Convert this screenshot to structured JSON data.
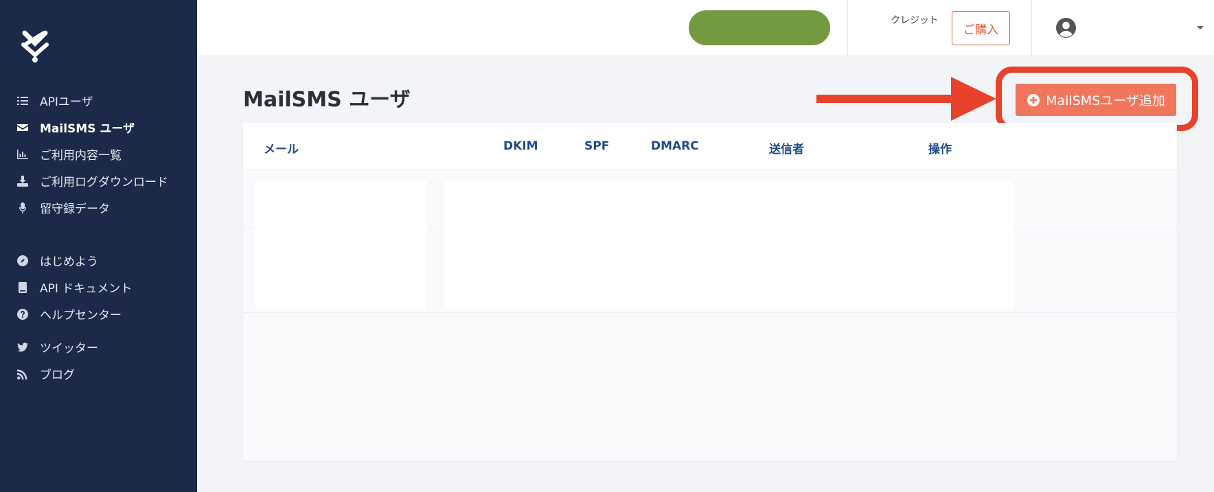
{
  "sidebar": {
    "items_primary": [
      {
        "label": "APIユーザ",
        "icon": "list-icon"
      },
      {
        "label": "MailSMS ユーザ",
        "icon": "envelope-icon",
        "active": true
      },
      {
        "label": "ご利用内容一覧",
        "icon": "bar-chart-icon"
      },
      {
        "label": "ご利用ログダウンロード",
        "icon": "download-icon"
      },
      {
        "label": "留守録データ",
        "icon": "microphone-icon"
      }
    ],
    "items_secondary": [
      {
        "label": "はじめよう",
        "icon": "compass-icon"
      },
      {
        "label": "API ドキュメント",
        "icon": "book-icon"
      },
      {
        "label": "ヘルプセンター",
        "icon": "question-circle-icon"
      }
    ],
    "items_social": [
      {
        "label": "ツイッター",
        "icon": "twitter-icon"
      },
      {
        "label": "ブログ",
        "icon": "rss-icon"
      }
    ]
  },
  "header": {
    "credit_label": "クレジット",
    "buy_label": "ご購入",
    "redacted_color": "#749a41"
  },
  "main": {
    "title": "MailSMS ユーザ",
    "add_button_label": "MailSMSユーザ追加",
    "table": {
      "columns": [
        "メール",
        "DKIM",
        "SPF",
        "DMARC",
        "送信者",
        "操作"
      ]
    }
  },
  "colors": {
    "sidebar_bg": "#1b2a48",
    "accent": "#f0775c",
    "annotation": "#e8432a",
    "column_header": "#1f4a8a"
  }
}
